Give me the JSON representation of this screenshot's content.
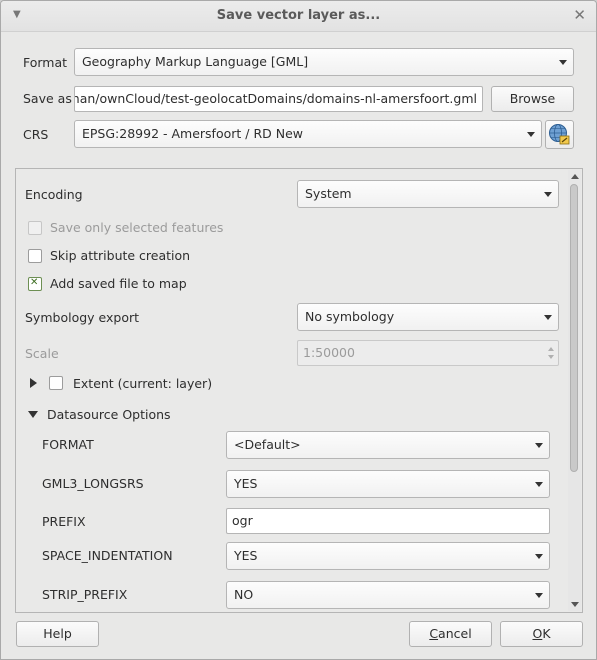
{
  "window": {
    "title": "Save vector layer as..."
  },
  "format": {
    "label": "Format",
    "value": "Geography Markup Language [GML]"
  },
  "save_as": {
    "label": "Save as",
    "value": "me/johan/ownCloud/test-geolocatDomains/domains-nl-amersfoort.gml",
    "browse_label": "Browse"
  },
  "crs": {
    "label": "CRS",
    "value": "EPSG:28992 - Amersfoort / RD New"
  },
  "options": {
    "encoding_label": "Encoding",
    "encoding_value": "System",
    "save_selected_label": "Save only selected features",
    "skip_attr_label": "Skip attribute creation",
    "add_to_map_label": "Add saved file to map",
    "symbology_label": "Symbology export",
    "symbology_value": "No symbology",
    "scale_label": "Scale",
    "scale_value": "1:50000",
    "extent_label": "Extent (current: layer)",
    "datasource_label": "Datasource Options"
  },
  "datasource": {
    "format_label": "FORMAT",
    "format_value": "<Default>",
    "gml3_label": "GML3_LONGSRS",
    "gml3_value": "YES",
    "prefix_label": "PREFIX",
    "prefix_value": "ogr",
    "space_label": "SPACE_INDENTATION",
    "space_value": "YES",
    "strip_label": "STRIP_PREFIX",
    "strip_value": "NO"
  },
  "buttons": {
    "help": "Help",
    "cancel_prefix": "",
    "cancel_mnemonic": "C",
    "cancel_rest": "ancel",
    "ok_mnemonic": "O",
    "ok_rest": "K"
  },
  "colors": {
    "window_bg": "#e8e8e7",
    "checked_mark": "#3f6f24",
    "disabled_text": "#9b9b9b"
  }
}
